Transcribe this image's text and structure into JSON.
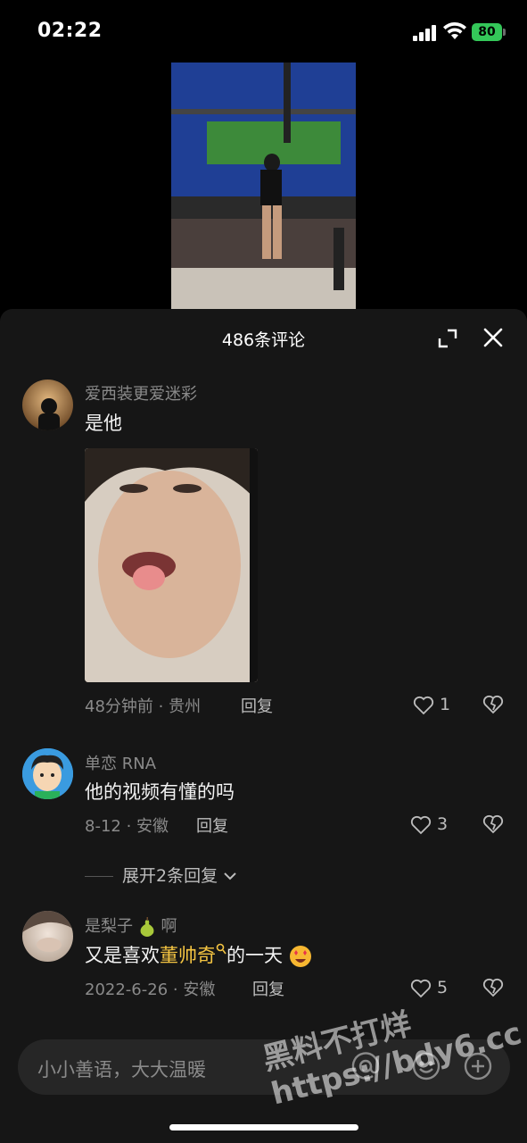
{
  "status_bar": {
    "time": "02:22",
    "battery": "80"
  },
  "sheet": {
    "title": "486条评论"
  },
  "comments": [
    {
      "username": "爱西装更爱迷彩",
      "text": "是他",
      "meta": "48分钟前 · 贵州",
      "reply": "回复",
      "likes": "1"
    },
    {
      "username": "单恋 RNA",
      "text": "他的视频有懂的吗",
      "meta": "8-12 · 安徽",
      "reply": "回复",
      "likes": "3",
      "expand_replies": "展开2条回复"
    },
    {
      "username": "是梨子",
      "username_suffix": "啊",
      "text_before": "又是喜欢",
      "text_link": "董帅奇",
      "text_after": "的一天",
      "meta": "2022-6-26 · 安徽",
      "reply": "回复",
      "likes": "5"
    }
  ],
  "input": {
    "placeholder": "小小善语，大大温暖"
  },
  "watermark": {
    "line1": "黑料不打烊",
    "line2": "https://bdy6.cc"
  },
  "colors": {
    "battery": "#34c759",
    "link": "#f5c542",
    "sheet": "#161616"
  },
  "icons": [
    "signal-icon",
    "wifi-icon",
    "battery-icon",
    "expand-icon",
    "close-icon",
    "heart-icon",
    "broken-heart-icon",
    "chevron-down-icon",
    "pear-emoji",
    "heart-eyes-emoji",
    "search-mini-icon",
    "at-icon",
    "emoji-icon",
    "plus-icon"
  ]
}
